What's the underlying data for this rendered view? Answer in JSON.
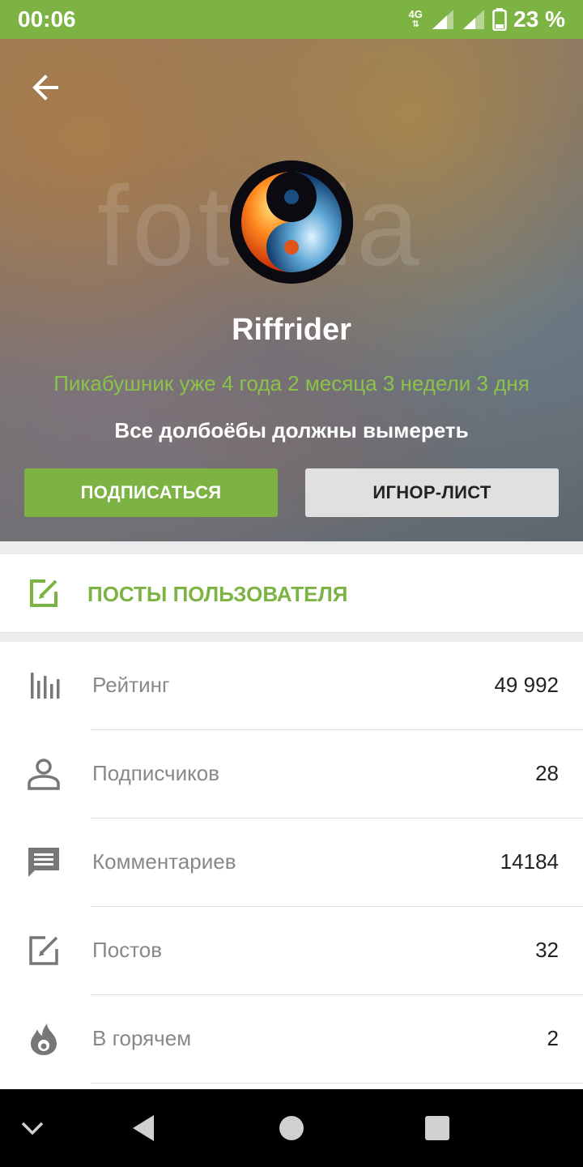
{
  "status_bar": {
    "time": "00:06",
    "network": "4G",
    "battery": "23 %"
  },
  "profile": {
    "username": "Riffrider",
    "tenure": "Пикабушник уже 4 года 2 месяца 3 недели 3 дня",
    "motto": "Все долбоёбы должны вымереть",
    "subscribe_label": "ПОДПИСАТЬСЯ",
    "ignore_label": "ИГНОР-ЛИСТ"
  },
  "posts_link": {
    "label": "ПОСТЫ ПОЛЬЗОВАТЕЛЯ",
    "icon": "edit-icon"
  },
  "stats": [
    {
      "label": "Рейтинг",
      "value": "49 992",
      "icon": "rating-icon"
    },
    {
      "label": "Подписчиков",
      "value": "28",
      "icon": "person-icon"
    },
    {
      "label": "Комментариев",
      "value": "14184",
      "icon": "comment-icon"
    },
    {
      "label": "Постов",
      "value": "32",
      "icon": "edit-icon"
    },
    {
      "label": "В горячем",
      "value": "2",
      "icon": "flame-icon"
    }
  ],
  "colors": {
    "accent": "#7cb342",
    "tenure_text": "#8bc34a",
    "ignore_button": "#e0e0e0"
  }
}
